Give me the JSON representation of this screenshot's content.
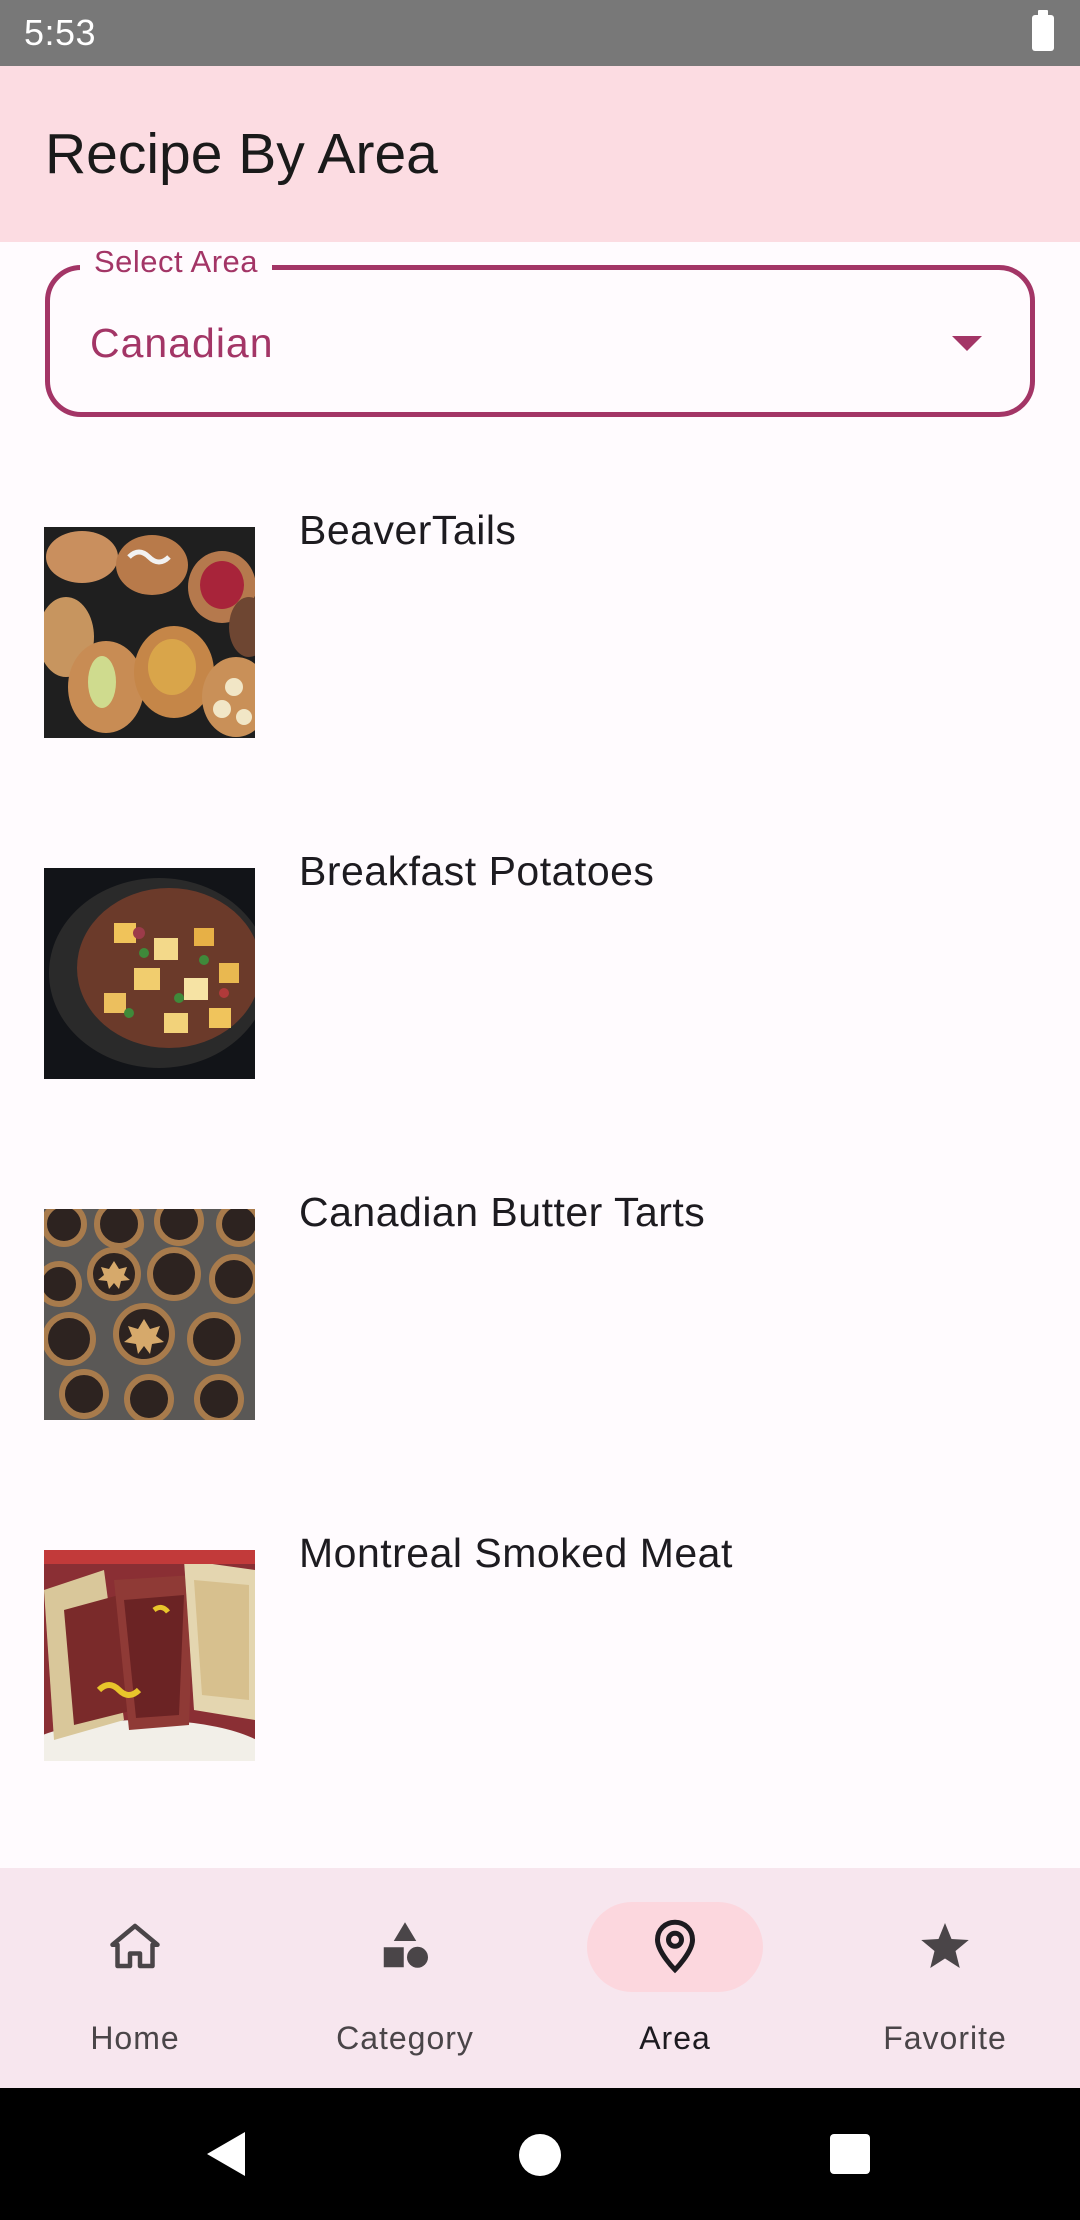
{
  "status_bar": {
    "time": "5:53"
  },
  "app_bar": {
    "title": "Recipe By Area"
  },
  "area_select": {
    "label": "Select Area",
    "value": "Canadian"
  },
  "recipes": [
    {
      "name": "BeaverTails"
    },
    {
      "name": "Breakfast Potatoes"
    },
    {
      "name": "Canadian Butter Tarts"
    },
    {
      "name": "Montreal Smoked Meat"
    }
  ],
  "bottom_nav": {
    "items": [
      {
        "label": "Home",
        "icon": "home-icon",
        "active": false
      },
      {
        "label": "Category",
        "icon": "category-icon",
        "active": false
      },
      {
        "label": "Area",
        "icon": "location-pin-icon",
        "active": true
      },
      {
        "label": "Favorite",
        "icon": "star-icon",
        "active": false
      }
    ]
  },
  "colors": {
    "accent": "#a33566",
    "app_bar_bg": "#fcdce2",
    "nav_bg": "#f7e6ee",
    "nav_active_pill": "#fcd7de"
  }
}
